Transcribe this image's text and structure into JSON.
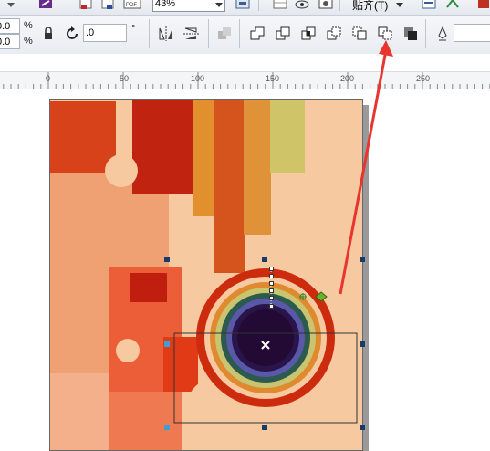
{
  "toolbar_top": {
    "zoom_value": "43%",
    "paste_label": "贴齐(T)"
  },
  "toolbar_second": {
    "x_value": "0.0",
    "y_value": "0.0",
    "x_unit": "%",
    "y_unit": "%",
    "rotation_value": ".0",
    "rotation_unit": "°",
    "outline_field_value": ""
  },
  "ruler": {
    "labels": [
      "0",
      "50",
      "100",
      "150",
      "200",
      "250"
    ]
  },
  "colors": {
    "arrow": "#e8362e",
    "page_bg": "#f7c9a0",
    "ring_outer": "#cc2b0e",
    "ring_core": "#220a35"
  },
  "icons": {
    "combine": "combine-icon",
    "weld": "weld-icon",
    "trim": "trim-icon",
    "intersect": "intersect-icon",
    "simplify": "simplify-icon",
    "front_minus_back": "front-minus-back-icon",
    "back_minus_front": "back-minus-front-icon",
    "boundary": "boundary-icon"
  }
}
